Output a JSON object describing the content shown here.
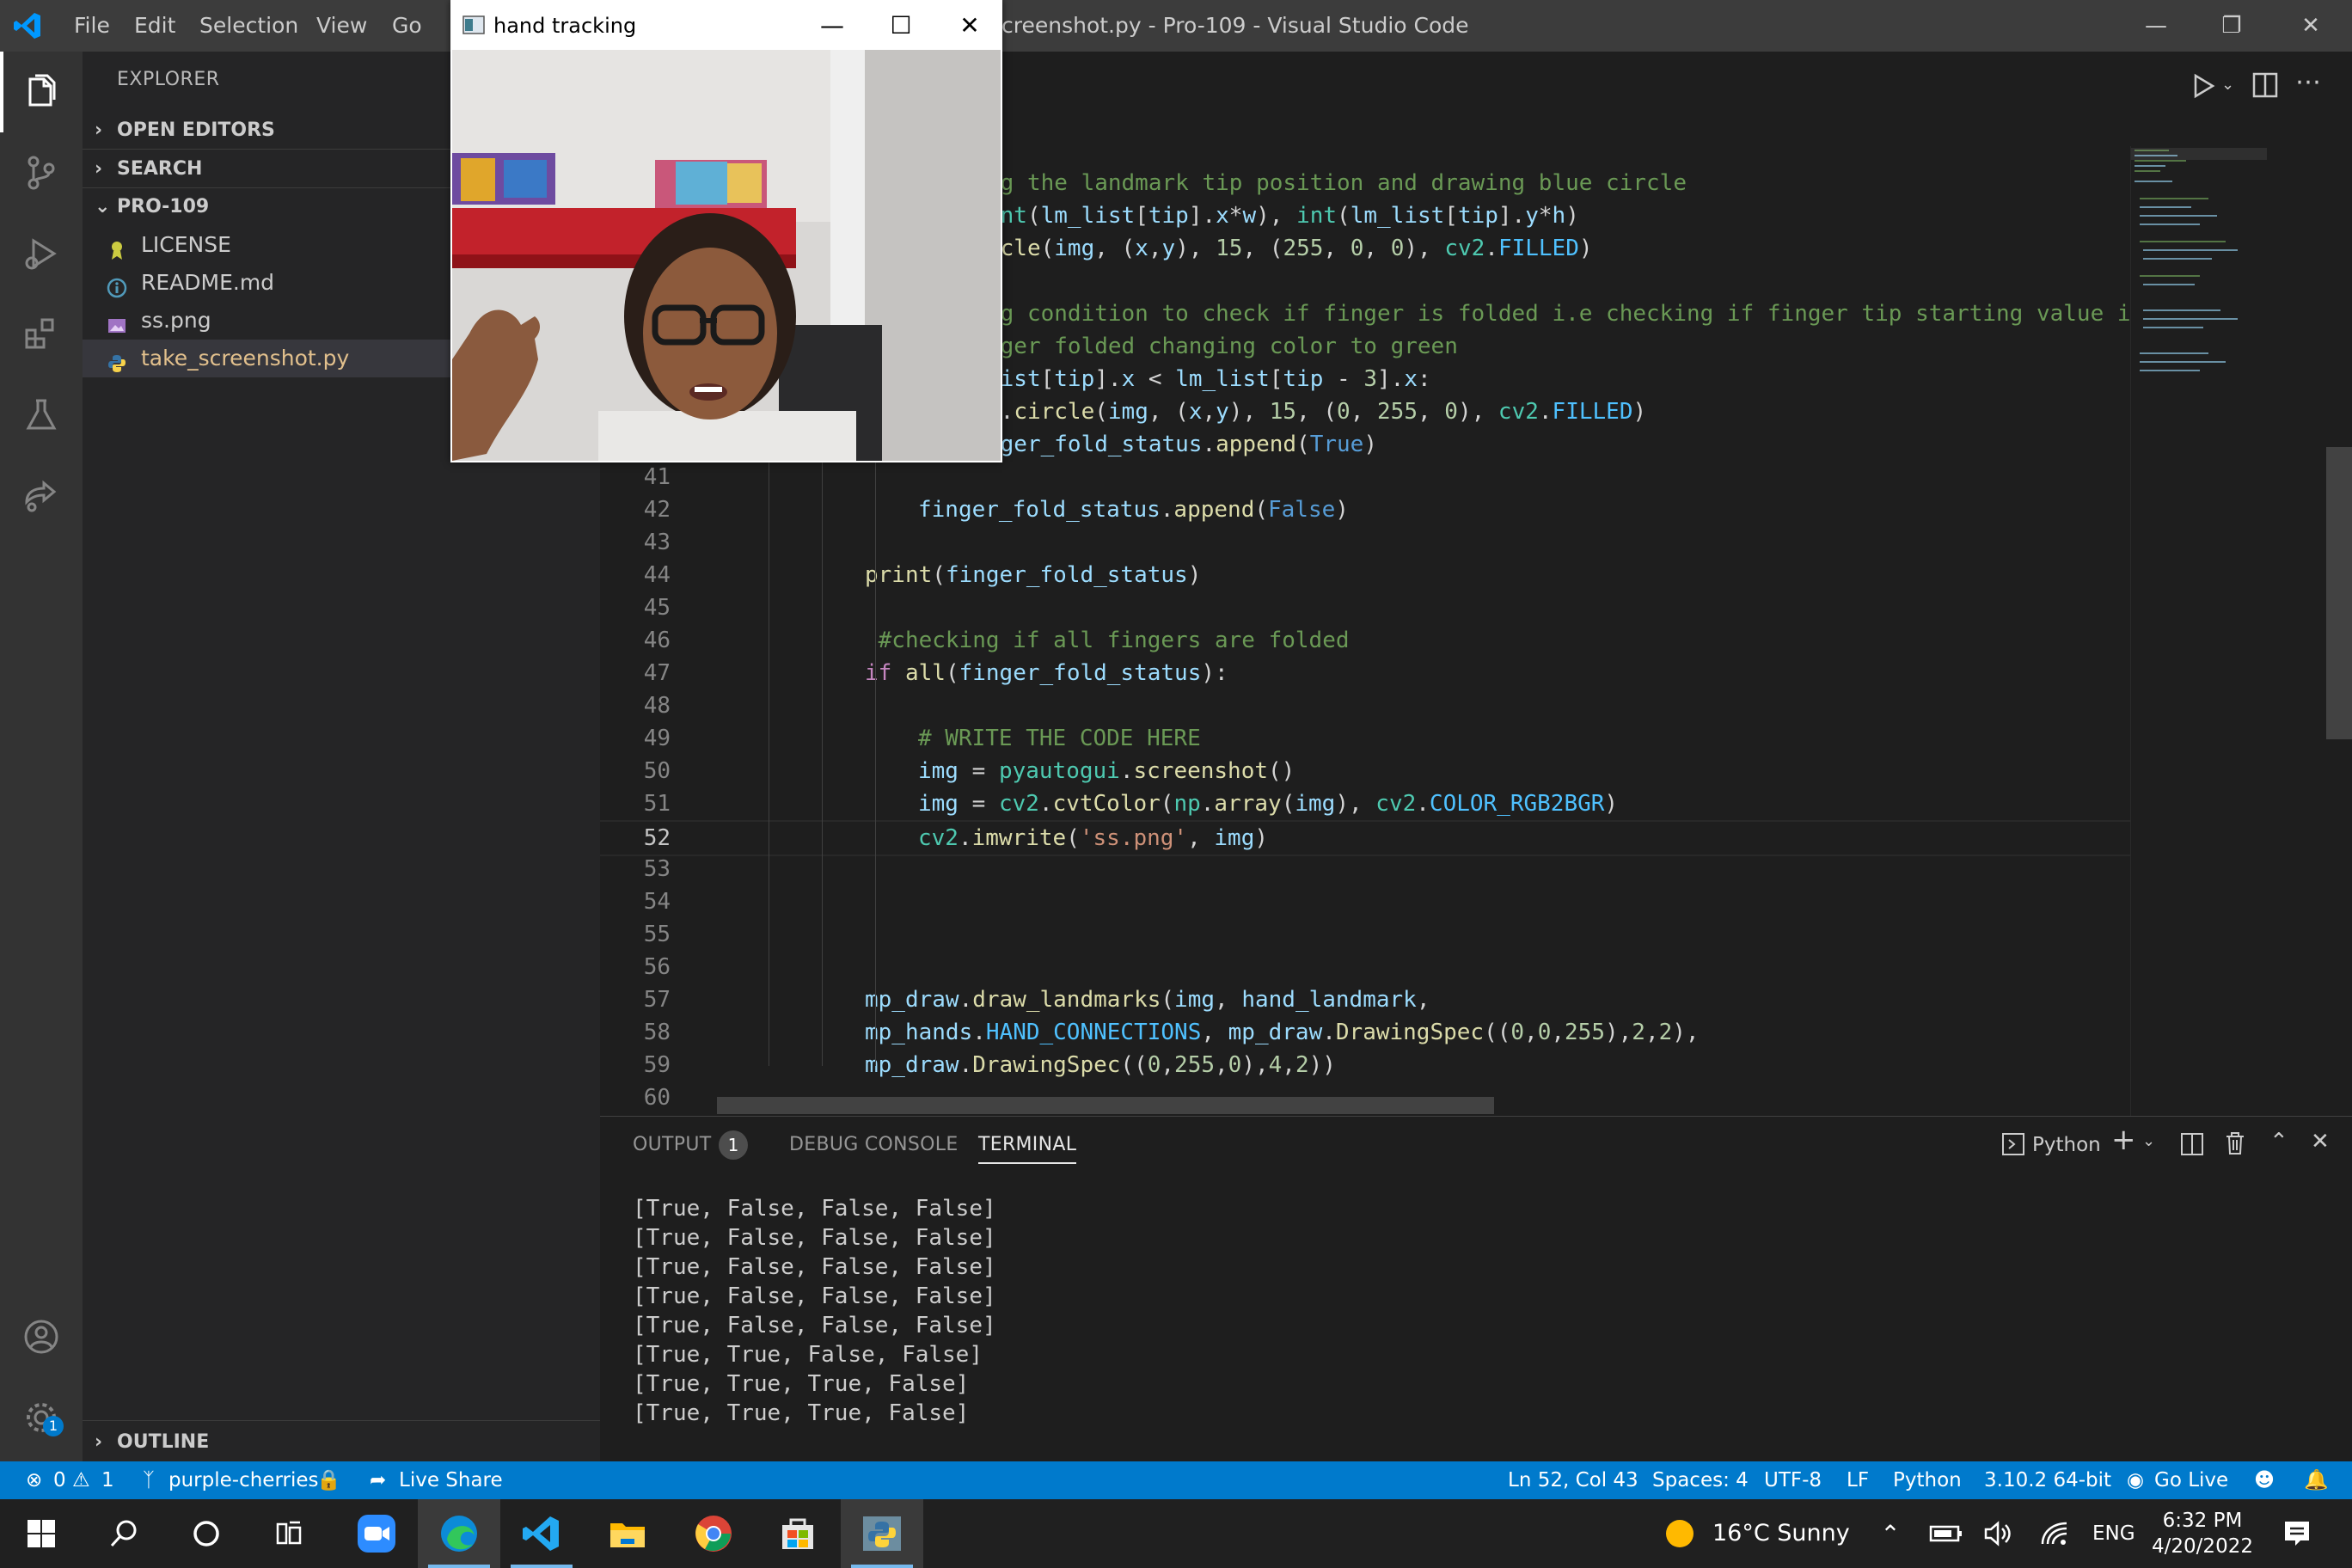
{
  "titlebar": {
    "menus": [
      "File",
      "Edit",
      "Selection",
      "View",
      "Go"
    ],
    "title": "creenshot.py - Pro-109 - Visual Studio Code"
  },
  "sidebar": {
    "title": "EXPLORER",
    "sections": {
      "open_editors": "OPEN EDITORS",
      "search": "SEARCH",
      "project": "PRO-109",
      "outline": "OUTLINE"
    },
    "files": [
      {
        "name": "LICENSE",
        "icon": "license-icon"
      },
      {
        "name": "README.md",
        "icon": "info-icon"
      },
      {
        "name": "ss.png",
        "icon": "image-icon"
      },
      {
        "name": "take_screenshot.py",
        "icon": "python-icon"
      }
    ]
  },
  "camera_window": {
    "title": "hand tracking"
  },
  "editor": {
    "active_line": 52,
    "lines": [
      {
        "n": "",
        "html": "<span class='cmt'>ng the landmark tip position and drawing blue circle</span>",
        "indent": 0
      },
      {
        "n": "",
        "html": "<span class='cls'>int</span><span class='pl'>(</span><span class='var'>lm_list</span><span class='pl'>[</span><span class='var'>tip</span><span class='pl'>].</span><span class='var'>x</span><span class='pl'>*</span><span class='var'>w</span><span class='pl'>), </span><span class='cls'>int</span><span class='pl'>(</span><span class='var'>lm_list</span><span class='pl'>[</span><span class='var'>tip</span><span class='pl'>].</span><span class='var'>y</span><span class='pl'>*</span><span class='var'>h</span><span class='pl'>)</span>",
        "indent": 0
      },
      {
        "n": "",
        "html": "<span class='fn'>rcle</span><span class='pl'>(</span><span class='var'>img</span><span class='pl'>, (</span><span class='var'>x</span><span class='pl'>,</span><span class='var'>y</span><span class='pl'>), </span><span class='num'>15</span><span class='pl'>, (</span><span class='num'>255</span><span class='pl'>, </span><span class='num'>0</span><span class='pl'>, </span><span class='num'>0</span><span class='pl'>), </span><span class='cls'>cv2</span><span class='pl'>.</span><span class='const'>FILLED</span><span class='pl'>)</span>",
        "indent": 0
      },
      {
        "n": "",
        "html": "",
        "indent": 0
      },
      {
        "n": "",
        "html": "<span class='cmt'>ng condition to check if finger is folded i.e checking if finger tip starting value i</span>",
        "indent": 0
      },
      {
        "n": "",
        "html": "<span class='cmt'>nger folded changing color to green</span>",
        "indent": 0
      },
      {
        "n": "",
        "html": "<span class='var'>list</span><span class='pl'>[</span><span class='var'>tip</span><span class='pl'>].</span><span class='var'>x</span><span class='pl'> &lt; </span><span class='var'>lm_list</span><span class='pl'>[</span><span class='var'>tip</span><span class='pl'> - </span><span class='num'>3</span><span class='pl'>].</span><span class='var'>x</span><span class='pl'>:</span>",
        "indent": 0
      },
      {
        "n": "",
        "html": "<span class='cls'>2</span><span class='pl'>.</span><span class='fn'>circle</span><span class='pl'>(</span><span class='var'>img</span><span class='pl'>, (</span><span class='var'>x</span><span class='pl'>,</span><span class='var'>y</span><span class='pl'>), </span><span class='num'>15</span><span class='pl'>, (</span><span class='num'>0</span><span class='pl'>, </span><span class='num'>255</span><span class='pl'>, </span><span class='num'>0</span><span class='pl'>), </span><span class='cls'>cv2</span><span class='pl'>.</span><span class='const'>FILLED</span><span class='pl'>)</span>",
        "indent": 0
      },
      {
        "n": "",
        "html": "<span class='var'>nger_fold_status</span><span class='pl'>.</span><span class='fn'>append</span><span class='pl'>(</span><span class='cst'>True</span><span class='pl'>)</span>",
        "indent": 0
      },
      {
        "n": "41",
        "html": "",
        "indent": 0
      },
      {
        "n": "42",
        "html": "<span class='var'>finger_fold_status</span><span class='pl'>.</span><span class='fn'>append</span><span class='pl'>(</span><span class='cst'>False</span><span class='pl'>)</span>",
        "indent": 3
      },
      {
        "n": "43",
        "html": "",
        "indent": 0
      },
      {
        "n": "44",
        "html": "<span class='fn'>print</span><span class='pl'>(</span><span class='var'>finger_fold_status</span><span class='pl'>)</span>",
        "indent": 2
      },
      {
        "n": "45",
        "html": "",
        "indent": 0
      },
      {
        "n": "46",
        "html": "<span class='cmt'> #checking if all fingers are folded</span>",
        "indent": 2
      },
      {
        "n": "47",
        "html": "<span class='kw'>if</span><span class='pl'> </span><span class='fn'>all</span><span class='pl'>(</span><span class='var'>finger_fold_status</span><span class='pl'>):</span>",
        "indent": 2
      },
      {
        "n": "48",
        "html": "",
        "indent": 0
      },
      {
        "n": "49",
        "html": "<span class='cmt'># WRITE THE CODE HERE</span>",
        "indent": 3
      },
      {
        "n": "50",
        "html": "<span class='var'>img</span><span class='pl'> = </span><span class='cls'>pyautogui</span><span class='pl'>.</span><span class='fn'>screenshot</span><span class='pl'>()</span>",
        "indent": 3
      },
      {
        "n": "51",
        "html": "<span class='var'>img</span><span class='pl'> = </span><span class='cls'>cv2</span><span class='pl'>.</span><span class='fn'>cvtColor</span><span class='pl'>(</span><span class='cls'>np</span><span class='pl'>.</span><span class='fn'>array</span><span class='pl'>(</span><span class='var'>img</span><span class='pl'>), </span><span class='cls'>cv2</span><span class='pl'>.</span><span class='const'>COLOR_RGB2BGR</span><span class='pl'>)</span>",
        "indent": 3
      },
      {
        "n": "52",
        "html": "<span class='cls'>cv2</span><span class='pl'>.</span><span class='fn'>imwrite</span><span class='pl'>(</span><span class='str'>'ss.png'</span><span class='pl'>, </span><span class='var'>img</span><span class='pl'>)</span>",
        "indent": 3
      },
      {
        "n": "53",
        "html": "",
        "indent": 0
      },
      {
        "n": "54",
        "html": "",
        "indent": 0
      },
      {
        "n": "55",
        "html": "",
        "indent": 0
      },
      {
        "n": "56",
        "html": "",
        "indent": 0
      },
      {
        "n": "57",
        "html": "<span class='var'>mp_draw</span><span class='pl'>.</span><span class='fn'>draw_landmarks</span><span class='pl'>(</span><span class='var'>img</span><span class='pl'>, </span><span class='var'>hand_landmark</span><span class='pl'>,</span>",
        "indent": 2
      },
      {
        "n": "58",
        "html": "<span class='var'>mp_hands</span><span class='pl'>.</span><span class='const'>HAND_CONNECTIONS</span><span class='pl'>, </span><span class='var'>mp_draw</span><span class='pl'>.</span><span class='fn'>DrawingSpec</span><span class='pl'>((</span><span class='num'>0</span><span class='pl'>,</span><span class='num'>0</span><span class='pl'>,</span><span class='num'>255</span><span class='pl'>),</span><span class='num'>2</span><span class='pl'>,</span><span class='num'>2</span><span class='pl'>),</span>",
        "indent": 2
      },
      {
        "n": "59",
        "html": "<span class='var'>mp_draw</span><span class='pl'>.</span><span class='fn'>DrawingSpec</span><span class='pl'>((</span><span class='num'>0</span><span class='pl'>,</span><span class='num'>255</span><span class='pl'>,</span><span class='num'>0</span><span class='pl'>),</span><span class='num'>4</span><span class='pl'>,</span><span class='num'>2</span><span class='pl'>))</span>",
        "indent": 2
      },
      {
        "n": "60",
        "html": "",
        "indent": 0
      }
    ]
  },
  "panel": {
    "tabs": {
      "output": "OUTPUT",
      "output_badge": "1",
      "debug": "DEBUG CONSOLE",
      "terminal": "TERMINAL"
    },
    "terminal_kind": "Python",
    "terminal_lines": [
      "[True, False, False, False]",
      "[True, False, False, False]",
      "[True, False, False, False]",
      "[True, False, False, False]",
      "[True, False, False, False]",
      "[True, True, False, False]",
      "[True, True, True, False]",
      "[True, True, True, False]"
    ]
  },
  "statusbar": {
    "errors": "0",
    "warnings": "1",
    "branch": "purple-cherries",
    "live_share": "Live Share",
    "position": "Ln 52, Col 43",
    "spaces": "Spaces: 4",
    "encoding": "UTF-8",
    "eol": "LF",
    "language": "Python",
    "interpreter": "3.10.2 64-bit",
    "go_live": "Go Live"
  },
  "activity": {
    "settings_badge": "1"
  },
  "taskbar": {
    "weather": "16°C  Sunny",
    "lang": "ENG",
    "time": "6:32 PM",
    "date": "4/20/2022"
  },
  "colors": {
    "status_bar": "#007acc",
    "accent": "#007acc"
  }
}
